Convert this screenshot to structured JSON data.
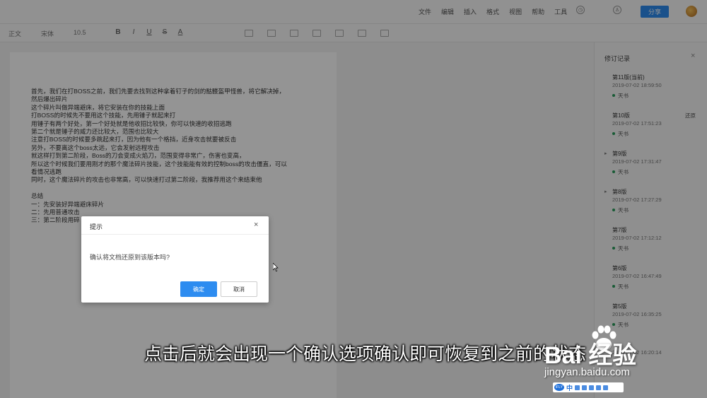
{
  "menu": [
    "文件",
    "编辑",
    "插入",
    "格式",
    "视图",
    "帮助",
    "工具"
  ],
  "toolbar": {
    "font_style": "正文",
    "font_name": "宋体",
    "font_size": "10.5",
    "bold": "B",
    "italic": "I",
    "underline": "U",
    "strike": "S",
    "color": "A"
  },
  "topbar": {
    "share_label": "分享"
  },
  "document": {
    "lines": [
      "首先，我们在打BOSS之前，我们先要去找到这种拿着钉子的剑的骷髅盔甲怪兽，将它解决掉，",
      "然后爆出碎片",
      "这个碎片叫做异端避床，将它安装在你的技能上面",
      "打BOSS的时候先不要用这个技能，先用锤子就起来打",
      "用锤子有两个好处，第一个好处就是他收招比较快，你可以快速的收招逃跑",
      "第二个就是锤子的威力还比较大，范围也比较大",
      "注意打BOSS的时候要多跳起来打，因为他有一个格挡，近身攻击就要被反击",
      "另外，不要离这个boss太远，它会发射远程攻击",
      "就这样打到第二阶段，Boss的刀会变成火焰刀，范围变得非常广，伤害也变高，",
      "所以这个时候我们要用刚才的那个魔法碎片技能，这个技能能有效的控制boss的攻击僵直，可以",
      "看情况逃跑",
      "同时，这个魔法碎片的攻击也非常高，可以快速打过第二阶段，我推荐用这个来结束他",
      "",
      "总结",
      "一：先安装好异端避床碎片",
      "二：先用普通攻击",
      "三：第二阶段用碎"
    ]
  },
  "panel": {
    "title": "修订记录",
    "close": "×",
    "restore_label": "还原",
    "versions": [
      {
        "name": "第11版(当前)",
        "time": "2019-07-02 18:59:50",
        "user": "天书",
        "arrow": ""
      },
      {
        "name": "第10版",
        "time": "2019-07-02 17:51:23",
        "user": "天书",
        "arrow": ""
      },
      {
        "name": "第9版",
        "time": "2019-07-02 17:31:47",
        "user": "天书",
        "arrow": "▸"
      },
      {
        "name": "第8版",
        "time": "2019-07-02 17:27:29",
        "user": "天书",
        "arrow": "▸"
      },
      {
        "name": "第7版",
        "time": "2019-07-02 17:12:12",
        "user": "天书",
        "arrow": ""
      },
      {
        "name": "第6版",
        "time": "2019-07-02 16:47:49",
        "user": "天书",
        "arrow": ""
      },
      {
        "name": "第5版",
        "time": "2019-07-02 16:35:25",
        "user": "天书",
        "arrow": ""
      },
      {
        "name": "",
        "time": "2019-07-02 16:20:14",
        "user": "",
        "arrow": ""
      }
    ]
  },
  "dialog": {
    "title": "提示",
    "close": "×",
    "message": "确认将文档还原到该版本吗?",
    "ok": "确定",
    "cancel": "取消"
  },
  "subtitle": "点击后就会出现一个确认选项确认即可恢复到之前的状态",
  "watermark": {
    "brand": "Bai  经验",
    "url": "jingyan.baidu.com"
  },
  "ime": {
    "logo": "iFLY",
    "mode": "中"
  }
}
